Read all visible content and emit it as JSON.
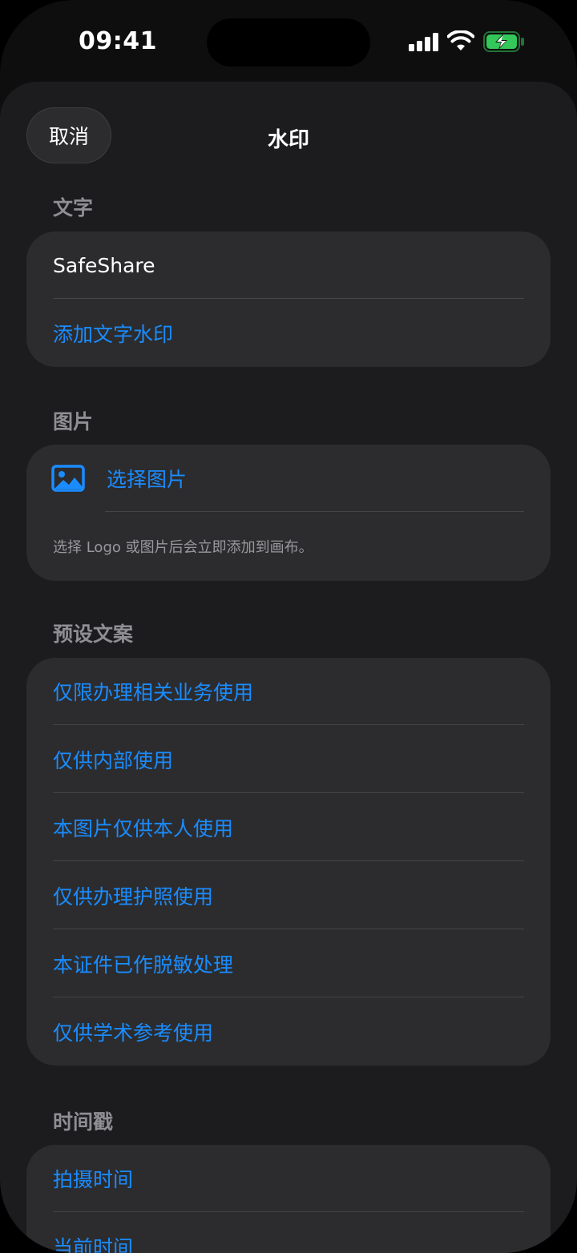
{
  "status_bar": {
    "time": "09:41"
  },
  "nav": {
    "cancel_label": "取消",
    "title": "水印"
  },
  "sections": {
    "text": {
      "label": "文字",
      "current_value": "SafeShare",
      "add_label": "添加文字水印"
    },
    "image": {
      "label": "图片",
      "choose_label": "选择图片",
      "icon": "photo-icon",
      "caption": "选择 Logo 或图片后会立即添加到画布。"
    },
    "presets": {
      "label": "预设文案",
      "items": [
        "仅限办理相关业务使用",
        "仅供内部使用",
        "本图片仅供本人使用",
        "仅供办理护照使用",
        "本证件已作脱敏处理",
        "仅供学术参考使用"
      ]
    },
    "timestamp": {
      "label": "时间戳",
      "items": [
        "拍摄时间",
        "当前时间"
      ]
    }
  },
  "colors": {
    "accent": "#1a8cff",
    "sheet_bg": "#1c1c1e",
    "card_bg": "#2c2c2e",
    "battery": "#34c759"
  }
}
